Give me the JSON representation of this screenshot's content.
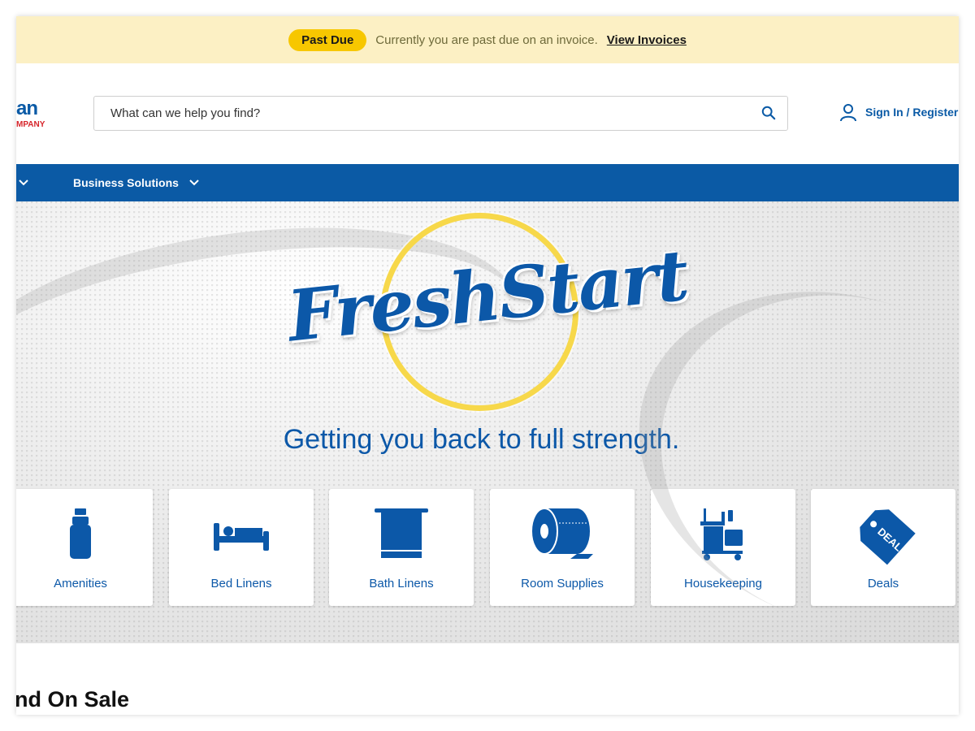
{
  "alert": {
    "badge": "Past Due",
    "message": "Currently you are past due on an invoice.",
    "link": "View Invoices"
  },
  "header": {
    "logo_top": "an",
    "logo_bottom": "MPANY",
    "search_placeholder": "What can we help you find?",
    "signin": "Sign In / Register"
  },
  "nav": {
    "item": "Business Solutions"
  },
  "hero": {
    "brand": "FreshStart",
    "tagline": "Getting you back to full strength."
  },
  "categories": [
    {
      "label": "Amenities",
      "icon": "bottle-icon"
    },
    {
      "label": "Bed Linens",
      "icon": "bed-icon"
    },
    {
      "label": "Bath Linens",
      "icon": "towel-icon"
    },
    {
      "label": "Room Supplies",
      "icon": "toilet-paper-icon"
    },
    {
      "label": "Housekeeping",
      "icon": "cleaning-cart-icon"
    },
    {
      "label": "Deals",
      "icon": "deals-tag-icon",
      "tag_text": "DEALS"
    }
  ],
  "section": {
    "title": "nd On Sale"
  },
  "colors": {
    "brand_blue": "#0b5aa5",
    "alert_bg": "#fcf0c4",
    "badge_yellow": "#f7c700"
  }
}
